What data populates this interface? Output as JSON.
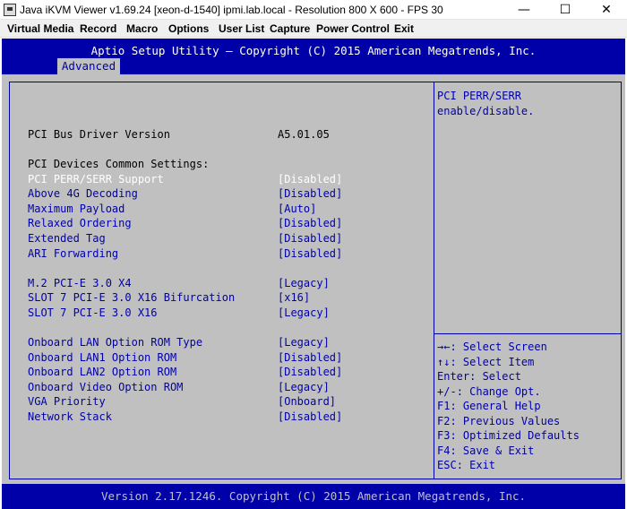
{
  "window": {
    "title": "Java iKVM Viewer v1.69.24 [xeon-d-1540] ipmi.lab.local - Resolution 800 X 600 - FPS 30",
    "minimize": "—",
    "maximize": "☐",
    "close": "✕"
  },
  "menu": [
    "Virtual Media",
    "Record",
    "Macro",
    "Options",
    "User List",
    "Capture",
    "Power Control",
    "Exit"
  ],
  "bios": {
    "header_title": "Aptio Setup Utility – Copyright (C) 2015 American Megatrends, Inc.",
    "tab": "Advanced",
    "driver_label": "PCI Bus Driver Version",
    "driver_value": "A5.01.05",
    "section_label": "PCI Devices Common Settings:",
    "settings": [
      {
        "label": "PCI PERR/SERR Support",
        "value": "[Disabled]"
      },
      {
        "label": "Above 4G Decoding",
        "value": "[Disabled]"
      },
      {
        "label": "Maximum Payload",
        "value": "[Auto]"
      },
      {
        "label": "Relaxed Ordering",
        "value": "[Disabled]"
      },
      {
        "label": "Extended Tag",
        "value": "[Disabled]"
      },
      {
        "label": "ARI Forwarding",
        "value": "[Disabled]"
      },
      {
        "label": "M.2 PCI-E 3.0 X4",
        "value": "[Legacy]"
      },
      {
        "label": "SLOT 7 PCI-E 3.0 X16 Bifurcation",
        "value": "[x16]"
      },
      {
        "label": "SLOT 7 PCI-E 3.0 X16",
        "value": "[Legacy]"
      },
      {
        "label": "Onboard LAN Option ROM Type",
        "value": "[Legacy]"
      },
      {
        "label": "Onboard LAN1 Option ROM",
        "value": "[Disabled]"
      },
      {
        "label": "Onboard LAN2 Option ROM",
        "value": "[Disabled]"
      },
      {
        "label": "Onboard Video Option ROM",
        "value": "[Legacy]"
      },
      {
        "label": "VGA Priority",
        "value": "[Onboard]"
      },
      {
        "label": "Network Stack",
        "value": "[Disabled]"
      }
    ],
    "help_text": [
      "PCI PERR/SERR",
      "enable/disable."
    ],
    "keys": [
      {
        "key": "→←",
        "desc": ": Select Screen"
      },
      {
        "key": "↑↓",
        "desc": ": Select Item"
      },
      {
        "key": "Enter",
        "desc": ": Select"
      },
      {
        "key": "+/-",
        "desc": ": Change Opt."
      },
      {
        "key": "F1",
        "desc": ": General Help"
      },
      {
        "key": "F2",
        "desc": ": Previous Values"
      },
      {
        "key": "F3",
        "desc": ": Optimized Defaults"
      },
      {
        "key": "F4",
        "desc": ": Save & Exit"
      },
      {
        "key": "ESC",
        "desc": ": Exit"
      }
    ],
    "footer": "Version 2.17.1246. Copyright (C) 2015 American Megatrends, Inc."
  },
  "colors": {
    "bios_blue": "#0000a8",
    "bios_gray": "#c0c0c0",
    "selected_text": "#ffffff"
  }
}
